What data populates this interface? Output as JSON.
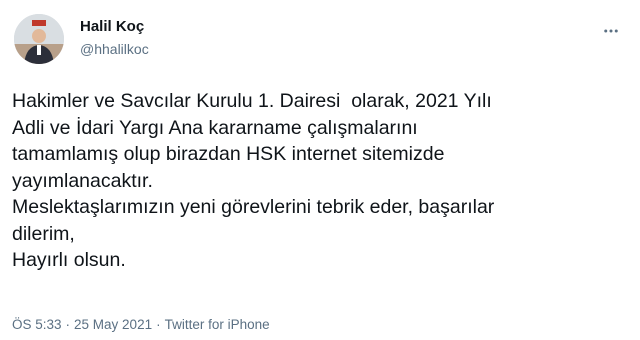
{
  "author": {
    "name": "Halil Koç",
    "handle": "@hhalilkoc",
    "avatar": "profile-photo"
  },
  "tweet": {
    "lines": [
      "Hakimler ve Savcılar Kurulu 1. Dairesi  olarak, 2021 Yılı",
      "Adli ve İdari Yargı Ana kararname çalışmalarını",
      "tamamlamış olup birazdan HSK internet sitemizde",
      "yayımlanacaktır.",
      "Meslektaşlarımızın yeni görevlerini tebrik eder, başarılar",
      "dilerim,",
      "Hayırlı olsun."
    ]
  },
  "meta": {
    "time": "ÖS 5:33",
    "separator": "·",
    "date": "25 May 2021",
    "source": "Twitter for iPhone"
  },
  "icons": {
    "more": "more-options-icon"
  },
  "colors": {
    "text": "#0f1419",
    "secondary": "#5b7083",
    "background": "#ffffff"
  }
}
